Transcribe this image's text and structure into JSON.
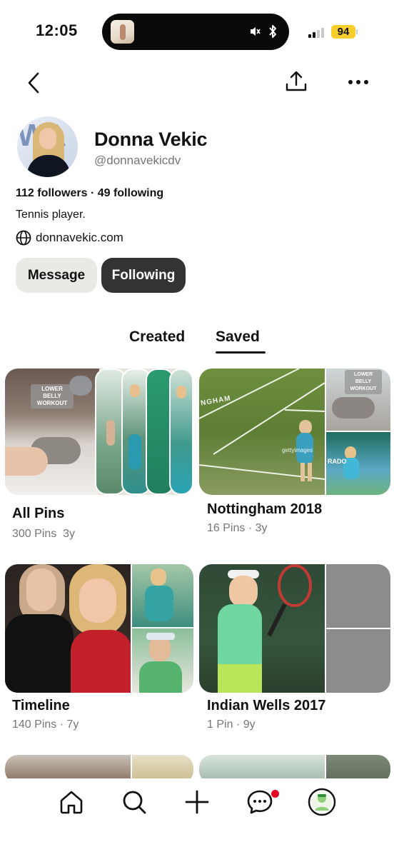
{
  "status_bar": {
    "time": "12:05",
    "battery": "94",
    "battery_color": "#f7ce2c"
  },
  "header": {
    "back_icon": "chevron-left-icon",
    "share_icon": "share-icon",
    "more_icon": "ellipsis-icon"
  },
  "profile": {
    "name": "Donna Vekic",
    "username": "@donnavekicdv",
    "counts": "112 followers · 49 following",
    "bio": "Tennis player.",
    "website": "donnavekic.com",
    "message_button": "Message",
    "following_button": "Following"
  },
  "tabs": {
    "created": "Created",
    "saved": "Saved",
    "active": "Saved"
  },
  "boards": [
    {
      "title": "All Pins",
      "pins": "300 Pins",
      "age": "3y"
    },
    {
      "title": "Nottingham 2018",
      "meta": "16 Pins · 3y"
    },
    {
      "title": "Timeline",
      "meta": "140 Pins · 7y"
    },
    {
      "title": "Indian Wells 2017",
      "meta": "1 Pin · 9y"
    }
  ],
  "cover_labels": {
    "workout": "LOWER BELLY WORKOUT",
    "getty": "gettyimages",
    "rado": "RADO",
    "venue": "NGHAM"
  },
  "bottom_nav": {
    "items": [
      "home-icon",
      "search-icon",
      "plus-icon",
      "inbox-icon",
      "profile-avatar"
    ],
    "accent": "#e60023"
  }
}
